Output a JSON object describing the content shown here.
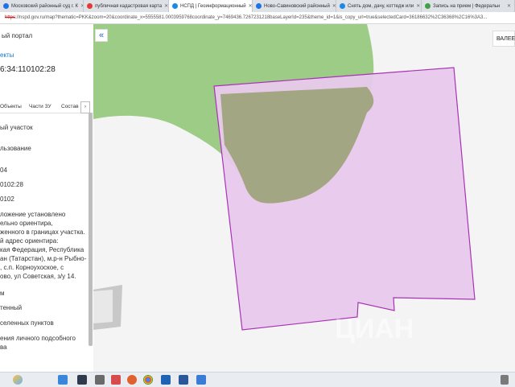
{
  "browser": {
    "tabs": [
      {
        "label": "Московский районный суд г. К",
        "color": "#1a73e8"
      },
      {
        "label": "публичная кадастровая карта",
        "color": "#e53935"
      },
      {
        "label": "НСПД | Геоинформационный",
        "color": "#1e88e5"
      },
      {
        "label": "Ново-Савиновский районный",
        "color": "#1a73e8"
      },
      {
        "label": "Снять дом, дачу, коттедж или",
        "color": "#1e88e5"
      },
      {
        "label": "Запись на прием | Федеральн",
        "color": "#43a047"
      }
    ],
    "url_scheme": "https",
    "url_rest": "://nspd.gov.ru/map?thematic=PKK&zoom=20&coordinate_x=5555581.0003959768coordinate_y=7469436.7267231218baseLayerId=235&theme_id=1&is_copy_url=true&selectedCard=36186632%2C36368%2C16%3A3..."
  },
  "panel": {
    "portal_title": "ый портал",
    "objects_link": "екты",
    "cadastral_number": "6:34:110102:28",
    "tabs": [
      "Объекты",
      "Части ЗУ",
      "Состав"
    ],
    "next_arrow": "›",
    "lines": [
      "ый участок",
      "льзование",
      "04",
      "0102:28",
      "0102",
      "ложение установлено",
      "ельно ориентира,",
      "женного в границах участка.",
      "й адрес ориентира:",
      "кая Федерация, Республика",
      "ан (Татарстан), м.р-н Рыбно-",
      ", с.п. Корноухоское, с",
      "ово, ул Советская, з/у 14.",
      "м",
      "тенный",
      "селенных пунктов",
      "ения личного подсобного",
      "ва"
    ]
  },
  "map": {
    "collapse_label": "«",
    "layers_label": "ВАЛЕЕ",
    "watermark": "ЦИАН",
    "colors": {
      "green": "#9dcc87",
      "parcel_fill": "#e8c9ec",
      "parcel_stroke": "#a733b4",
      "overlap": "#a3a682"
    }
  }
}
